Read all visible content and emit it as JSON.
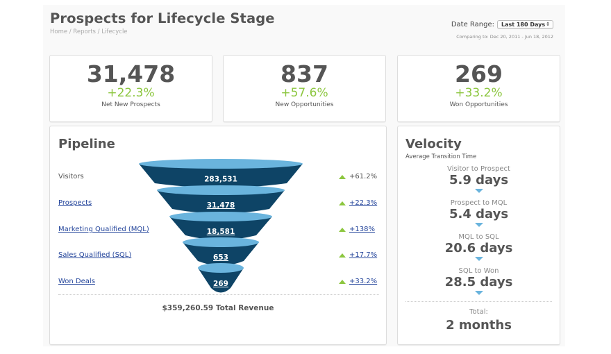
{
  "header": {
    "title": "Prospects for Lifecycle Stage",
    "breadcrumb": "Home / Reports / Lifecycle",
    "date_range_label": "Date Range:",
    "date_range_value": "Last 180 Days",
    "comparing": "Comparing to: Dec 20, 2011 - Jun 18, 2012"
  },
  "kpis": [
    {
      "value": "31,478",
      "change": "+22.3%",
      "label": "Net New Prospects"
    },
    {
      "value": "837",
      "change": "+57.6%",
      "label": "New Opportunities"
    },
    {
      "value": "269",
      "change": "+33.2%",
      "label": "Won Opportunities"
    }
  ],
  "pipeline": {
    "title": "Pipeline",
    "stages": [
      {
        "label": "Visitors",
        "value": "283,531",
        "change": "+61.2%",
        "link": false
      },
      {
        "label": "Prospects",
        "value": "31,478",
        "change": "+22.3%",
        "link": true
      },
      {
        "label": "Marketing Qualified (MQL)",
        "value": "18,581",
        "change": "+138%",
        "link": true
      },
      {
        "label": "Sales Qualified (SQL)",
        "value": "653",
        "change": "+17.7%",
        "link": true
      },
      {
        "label": "Won Deals",
        "value": "269",
        "change": "+33.2%",
        "link": true
      }
    ],
    "total_revenue": "$359,260.59 Total Revenue"
  },
  "velocity": {
    "title": "Velocity",
    "subtitle": "Average Transition Time",
    "items": [
      {
        "label": "Visitor to Prospect",
        "value": "5.9 days"
      },
      {
        "label": "Prospect to MQL",
        "value": "5.4 days"
      },
      {
        "label": "MQL to SQL",
        "value": "20.6 days"
      },
      {
        "label": "SQL to Won",
        "value": "28.5 days"
      }
    ],
    "total_label": "Total:",
    "total_value": "2 months"
  },
  "colors": {
    "accent_green": "#8cc63f",
    "funnel_dark": "#0e4466",
    "funnel_light": "#6ab4dd",
    "link_blue": "#24459b"
  }
}
